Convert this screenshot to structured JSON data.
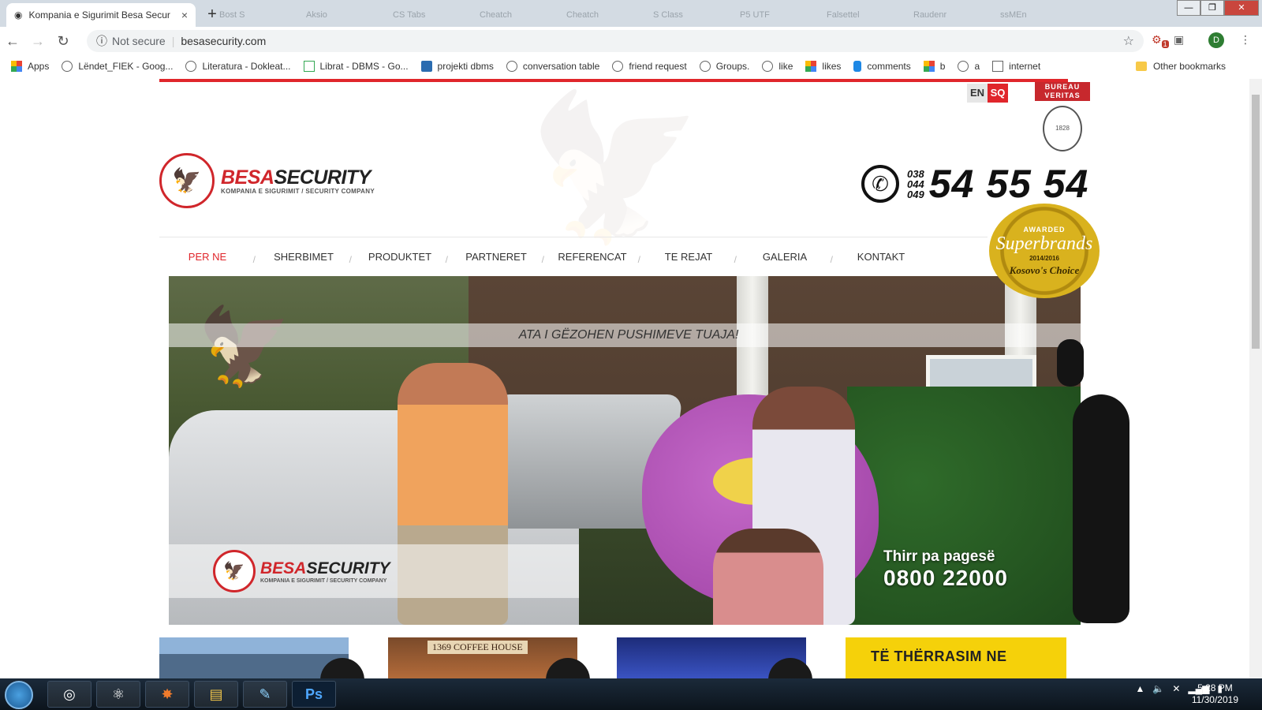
{
  "browser": {
    "active_tab_title": "Kompania e Sigurimit Besa Secur",
    "tab_close": "×",
    "background_tabs": [
      "Bost S",
      "Aksio",
      "CS Tabs",
      "Cheatch",
      "Cheatch",
      "S Class",
      "P5 UTF",
      "Falsettel",
      "Raudenr",
      "ssMEn"
    ],
    "new_tab": "+",
    "window_controls": [
      "—",
      "❐",
      "✕"
    ],
    "security_label": "Not secure",
    "url": "besasecurity.com",
    "profile_initial": "D",
    "ext_badge": "1"
  },
  "bookmarks": {
    "items": [
      {
        "label": "Apps",
        "icon": "apps-grid-icon"
      },
      {
        "label": "Lëndet_FIEK - Goog...",
        "icon": "globe-icon"
      },
      {
        "label": "Literatura - Dokleat...",
        "icon": "globe-icon"
      },
      {
        "label": "Librat - DBMS - Go...",
        "icon": "drive-icon"
      },
      {
        "label": "projekti dbms",
        "icon": "p-icon"
      },
      {
        "label": "conversation table",
        "icon": "blank-page-icon"
      },
      {
        "label": "friend request",
        "icon": "blank-page-icon"
      },
      {
        "label": "Groups.",
        "icon": "blank-page-icon"
      },
      {
        "label": "like",
        "icon": "blank-page-icon"
      },
      {
        "label": "likes",
        "icon": "grid-icon"
      },
      {
        "label": "comments",
        "icon": "db-icon"
      },
      {
        "label": "b",
        "icon": "windows-icon"
      },
      {
        "label": "a",
        "icon": "globe-icon"
      },
      {
        "label": "internet",
        "icon": "ost-icon"
      }
    ],
    "more": "»",
    "other": "Other bookmarks"
  },
  "site": {
    "lang_en": "EN",
    "lang_sq": "SQ",
    "bureau_veritas": "BUREAU VERITAS",
    "bv_year": "1828",
    "logo_besa": "BESA",
    "logo_security": "SECURITY",
    "logo_tagline": "KOMPANIA E SIGURIMIT / SECURITY COMPANY",
    "phone_codes": [
      "038",
      "044",
      "049"
    ],
    "phone_number": "54 55 54",
    "superbrands": {
      "awarded": "AWARDED",
      "name": "Superbrands",
      "years": "2014/2016",
      "choice": "Kosovo's Choice"
    },
    "nav": [
      "PER NE",
      "SHERBIMET",
      "PRODUKTET",
      "PARTNERET",
      "REFERENCAT",
      "TE REJAT",
      "GALERIA",
      "KONTAKT"
    ],
    "hero": {
      "headline": "ATA I GËZOHEN PUSHIMEVE TUAJA!",
      "freecall_label": "Thirr pa pagesë",
      "freecall_number": "0800 22000"
    },
    "cafe_sign": "1369 COFFEE HOUSE",
    "cta": "TË THËRRASIM NE"
  },
  "taskbar": {
    "apps": [
      "chrome",
      "atom",
      "xampp",
      "explorer",
      "notepad",
      "photoshop"
    ],
    "photoshop_label": "Ps",
    "time": "5:28 PM",
    "date": "11/30/2019"
  },
  "colors": {
    "brand_red": "#e0262b",
    "cta_yellow": "#f5d10a",
    "gold": "#d9b21e"
  }
}
